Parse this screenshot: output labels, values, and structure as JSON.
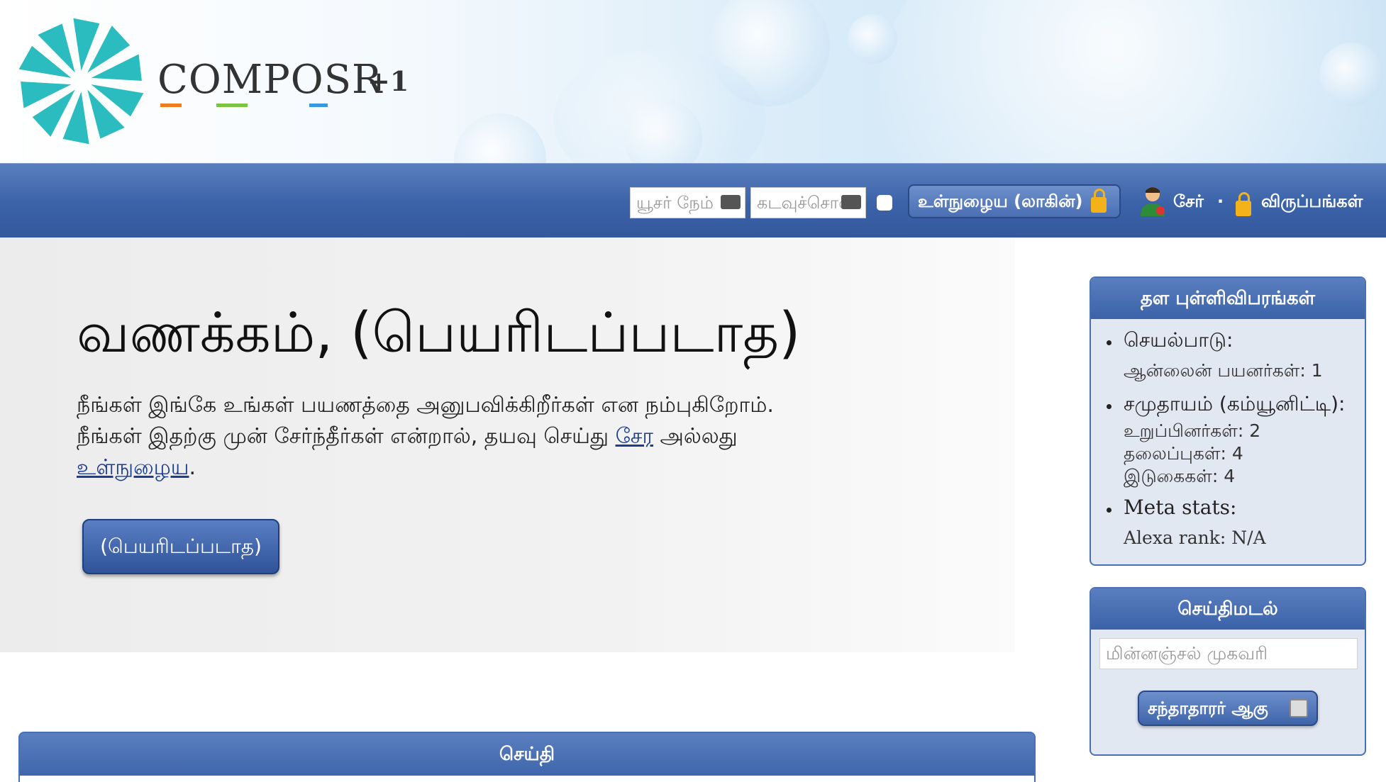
{
  "header": {
    "logo_text": "COMPOSR",
    "logo_plus": "+1",
    "logo_underline_colors": [
      "#f07c22",
      "#7cc243",
      "#3a98e0"
    ],
    "logo_color": "#2bbcbf"
  },
  "nav": {
    "username_placeholder": "யூசர் நேம்",
    "password_placeholder": "கடவுச்சொல்",
    "login_label": "உள்நுழைய (லாகின்)",
    "join_label": "சேர்",
    "separator": "·",
    "preferences_label": "விருப்பங்கள்"
  },
  "hero": {
    "title": "வணக்கம், (பெயரிடப்படாத)",
    "line1": "நீங்கள் இங்கே உங்கள் பயணத்தை அனுபவிக்கிறீர்கள் என நம்புகிறோம்.",
    "line2_prefix": "நீங்கள் இதற்கு முன் சேர்ந்தீர்கள் என்றால், தயவு செய்து ",
    "join_link": "சேர",
    "line2_middle": " அல்லது",
    "login_link": "உள்நுழைய",
    "line_end": ".",
    "button_label": "(பெயரிடப்படாத)"
  },
  "stats": {
    "title": "தள புள்ளிவிபரங்கள்",
    "activity_title": "செயல்பாடு:",
    "online_users": "ஆன்லைன் பயனர்கள்:  1",
    "community_title": "சமுதாயம் (கம்யூனிட்டி):",
    "members": "உறுப்பினர்கள்:  2",
    "topics": "தலைப்புகள்:  4",
    "posts": "இடுகைகள்:  4",
    "meta_title": "Meta stats:",
    "alexa": "Alexa rank:  N/A"
  },
  "newsletter": {
    "title": "செய்திமடல்",
    "email_placeholder": "மின்னஞ்சல் முகவரி",
    "subscribe_label": "சந்தாதாரர் ஆகு"
  },
  "news": {
    "title": "செய்தி"
  },
  "colors": {
    "nav_blue": "#3b62a8",
    "link_blue": "#1d3e8f",
    "lock_yellow": "#f3b21a"
  }
}
